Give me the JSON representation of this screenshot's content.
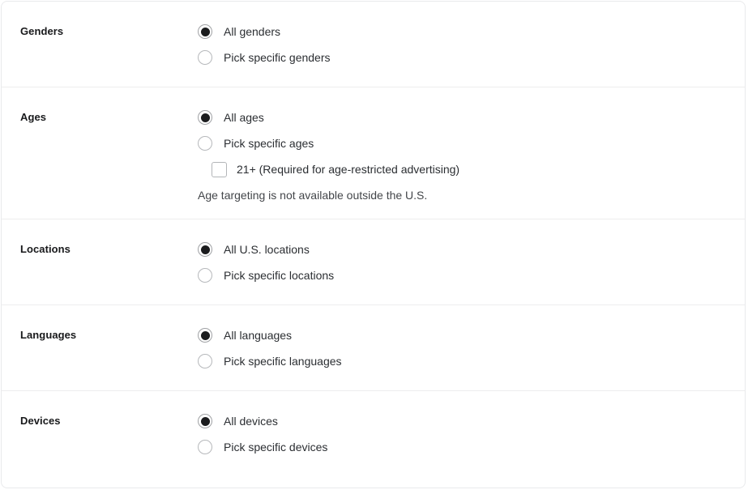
{
  "colors": {
    "card_bg": "#ffffff",
    "card_border": "#e9eaec",
    "divider": "#ededee",
    "label_text": "#18191b",
    "option_text": "#2b2e32",
    "helper_text": "#43464a",
    "control_border": "#b6b8bb",
    "radio_selected_fill": "#1b1c1e"
  },
  "sections": [
    {
      "id": "genders",
      "label": "Genders",
      "options": [
        {
          "label": "All genders",
          "selected": true
        },
        {
          "label": "Pick specific genders",
          "selected": false
        }
      ]
    },
    {
      "id": "ages",
      "label": "Ages",
      "options": [
        {
          "label": "All ages",
          "selected": true
        },
        {
          "label": "Pick specific ages",
          "selected": false
        }
      ],
      "checkbox": {
        "label": "21+ (Required for age-restricted advertising)",
        "checked": false
      },
      "note": "Age targeting is not available outside the U.S."
    },
    {
      "id": "locations",
      "label": "Locations",
      "options": [
        {
          "label": "All U.S. locations",
          "selected": true
        },
        {
          "label": "Pick specific locations",
          "selected": false
        }
      ]
    },
    {
      "id": "languages",
      "label": "Languages",
      "options": [
        {
          "label": "All languages",
          "selected": true
        },
        {
          "label": "Pick specific languages",
          "selected": false
        }
      ]
    },
    {
      "id": "devices",
      "label": "Devices",
      "options": [
        {
          "label": "All devices",
          "selected": true
        },
        {
          "label": "Pick specific devices",
          "selected": false
        }
      ]
    }
  ]
}
